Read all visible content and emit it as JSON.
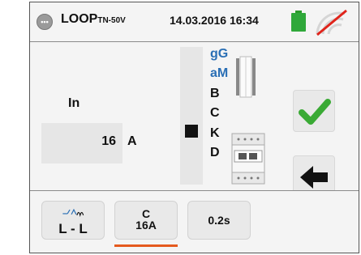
{
  "header": {
    "mode": "LOOP",
    "mode_sub": "TN-50V",
    "datetime": "14.03.2016 16:34",
    "battery_icon": "battery-full-icon",
    "signal_icon": "wireless-off-icon"
  },
  "parameter": {
    "label": "In",
    "value": "16",
    "unit": "A"
  },
  "curves": {
    "items": [
      "gG",
      "aM",
      "B",
      "C",
      "K",
      "D"
    ],
    "selected": "C"
  },
  "footer": {
    "btn1_label": "L - L",
    "btn2_line1": "C",
    "btn2_line2": "16A",
    "btn3_label": "0.2s"
  },
  "colors": {
    "accent_blue": "#2a6fb5",
    "confirm_green": "#3aaa35",
    "tab_underline": "#e55a1e",
    "battery_green": "#2fa83a",
    "no_signal_red": "#e0241b"
  }
}
